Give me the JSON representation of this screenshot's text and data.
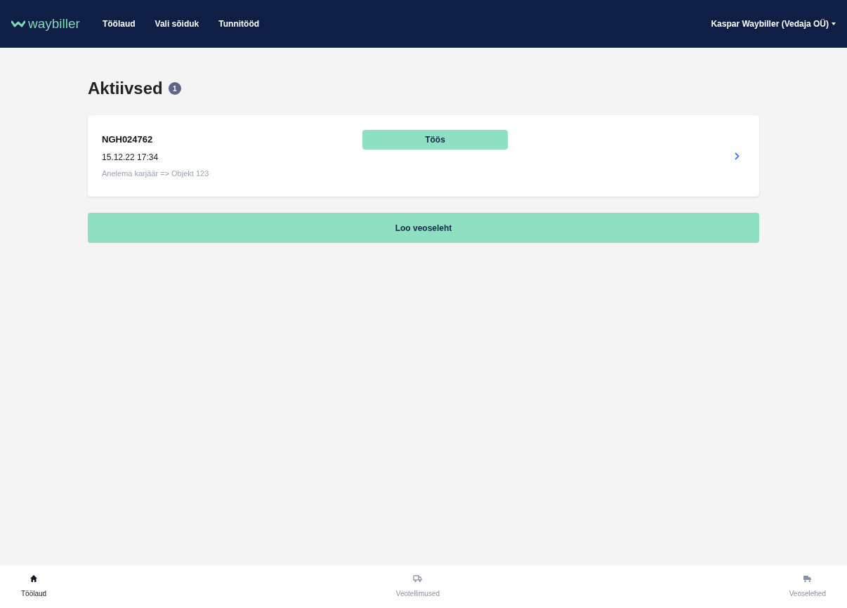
{
  "navbar": {
    "logo": "waybiller",
    "links": [
      {
        "label": "Töölaud"
      },
      {
        "label": "Vali sõiduk"
      },
      {
        "label": "Tunnitööd"
      }
    ],
    "user": "Kaspar Waybiller (Vedaja OÜ)"
  },
  "section": {
    "title": "Aktiivsed",
    "count": "1"
  },
  "waybills": [
    {
      "number": "NGH024762",
      "datetime": "15.12.22 17:34",
      "route": "Anelema karjäär => Objekt 123",
      "status": "Töös"
    }
  ],
  "create_button": "Loo veoseleht",
  "bottom_nav": [
    {
      "label": "Töölaud",
      "selected": true
    },
    {
      "label": "Veotellimused",
      "selected": false
    },
    {
      "label": "Veoselehed",
      "selected": false
    }
  ]
}
